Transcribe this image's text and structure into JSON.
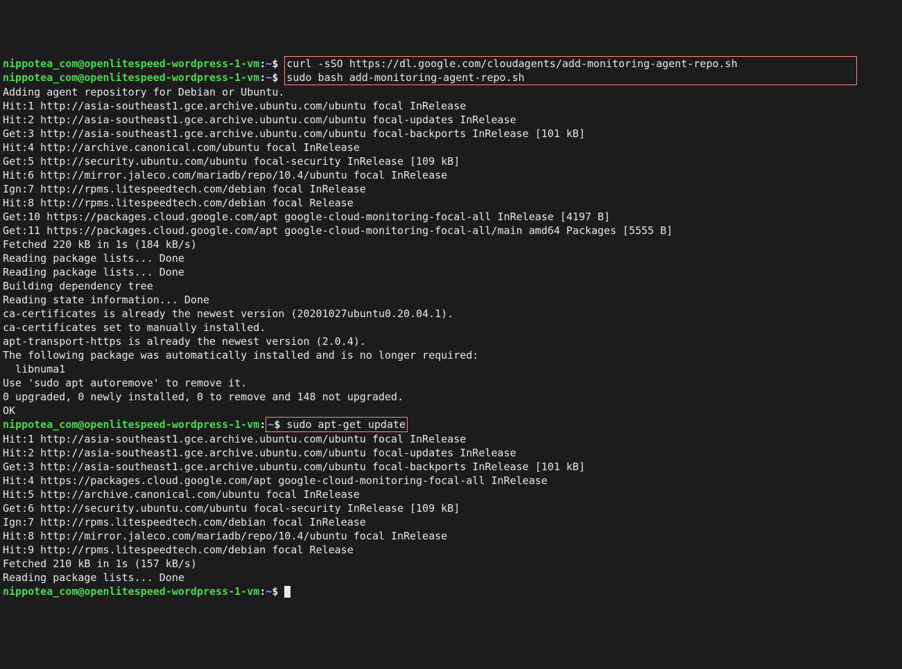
{
  "prompt": {
    "user_host": "nippotea_com@openlitespeed-wordpress-1-vm",
    "sep1": ":",
    "path": "~",
    "sep2": "$"
  },
  "cmd1": "curl -sSO https://dl.google.com/cloudagents/add-monitoring-agent-repo.sh",
  "cmd2": "sudo bash add-monitoring-agent-repo.sh",
  "out1": [
    "Adding agent repository for Debian or Ubuntu.",
    "Hit:1 http://asia-southeast1.gce.archive.ubuntu.com/ubuntu focal InRelease",
    "Hit:2 http://asia-southeast1.gce.archive.ubuntu.com/ubuntu focal-updates InRelease",
    "Get:3 http://asia-southeast1.gce.archive.ubuntu.com/ubuntu focal-backports InRelease [101 kB]",
    "Hit:4 http://archive.canonical.com/ubuntu focal InRelease",
    "Get:5 http://security.ubuntu.com/ubuntu focal-security InRelease [109 kB]",
    "Hit:6 http://mirror.jaleco.com/mariadb/repo/10.4/ubuntu focal InRelease",
    "Ign:7 http://rpms.litespeedtech.com/debian focal InRelease",
    "Hit:8 http://rpms.litespeedtech.com/debian focal Release",
    "Get:10 https://packages.cloud.google.com/apt google-cloud-monitoring-focal-all InRelease [4197 B]",
    "Get:11 https://packages.cloud.google.com/apt google-cloud-monitoring-focal-all/main amd64 Packages [5555 B]",
    "Fetched 220 kB in 1s (184 kB/s)",
    "Reading package lists... Done",
    "Reading package lists... Done",
    "Building dependency tree",
    "Reading state information... Done",
    "ca-certificates is already the newest version (20201027ubuntu0.20.04.1).",
    "ca-certificates set to manually installed.",
    "apt-transport-https is already the newest version (2.0.4).",
    "The following package was automatically installed and is no longer required:",
    "  libnuma1",
    "Use 'sudo apt autoremove' to remove it.",
    "0 upgraded, 0 newly installed, 0 to remove and 148 not upgraded.",
    "OK"
  ],
  "cmd3": "sudo apt-get update",
  "out2": [
    "Hit:1 http://asia-southeast1.gce.archive.ubuntu.com/ubuntu focal InRelease",
    "Hit:2 http://asia-southeast1.gce.archive.ubuntu.com/ubuntu focal-updates InRelease",
    "Get:3 http://asia-southeast1.gce.archive.ubuntu.com/ubuntu focal-backports InRelease [101 kB]",
    "Hit:4 https://packages.cloud.google.com/apt google-cloud-monitoring-focal-all InRelease",
    "Hit:5 http://archive.canonical.com/ubuntu focal InRelease",
    "Get:6 http://security.ubuntu.com/ubuntu focal-security InRelease [109 kB]",
    "Ign:7 http://rpms.litespeedtech.com/debian focal InRelease",
    "Hit:8 http://mirror.jaleco.com/mariadb/repo/10.4/ubuntu focal InRelease",
    "Hit:9 http://rpms.litespeedtech.com/debian focal Release",
    "Fetched 210 kB in 1s (157 kB/s)",
    "Reading package lists... Done"
  ]
}
